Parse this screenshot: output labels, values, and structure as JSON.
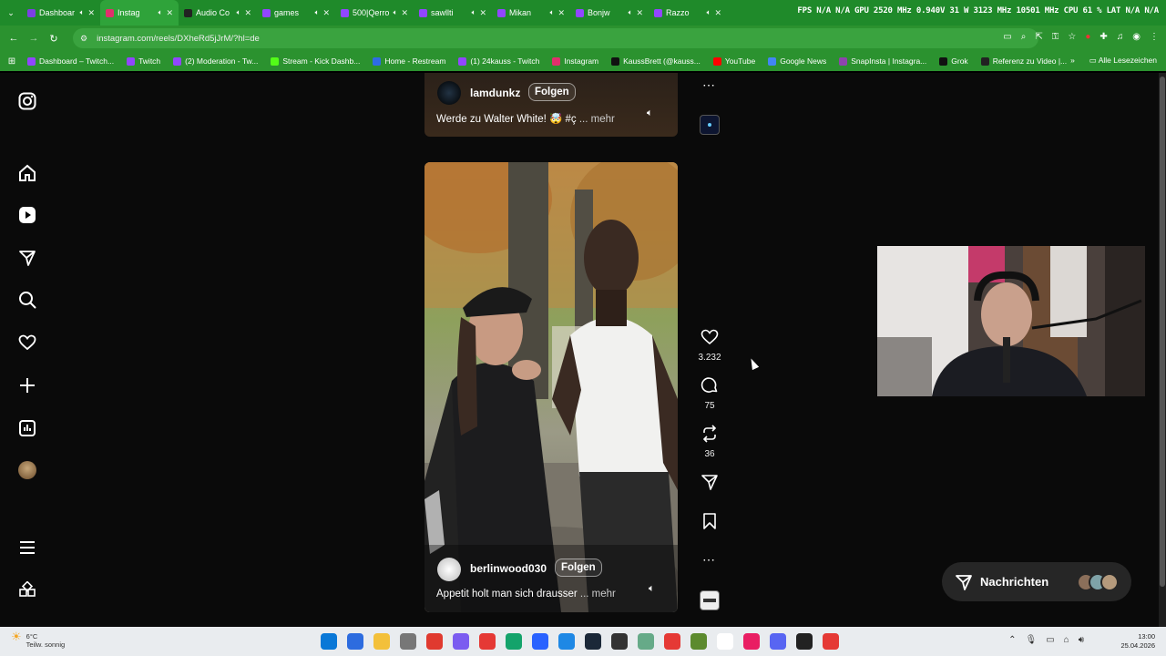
{
  "browser": {
    "tabs": [
      {
        "title": "Dashboar",
        "color": "#7b3fe4",
        "active": false
      },
      {
        "title": "Instag",
        "color": "#e1306c",
        "active": true
      },
      {
        "title": "Audio Co",
        "color": "#222222",
        "active": false
      },
      {
        "title": "games",
        "color": "#9146ff",
        "active": false
      },
      {
        "title": "500|Qerro",
        "color": "#9146ff",
        "active": false
      },
      {
        "title": "sawllti",
        "color": "#9146ff",
        "active": false
      },
      {
        "title": "Mikan",
        "color": "#9146ff",
        "active": false
      },
      {
        "title": "Bonjw",
        "color": "#9146ff",
        "active": false
      },
      {
        "title": "Razzo",
        "color": "#9146ff",
        "active": false
      }
    ],
    "overlay_stats": "FPS N/A N/A  GPU 2520 MHz 0.940V 31 W 3123 MHz 10501 MHz  CPU 61 %  LAT N/A N/A",
    "url": "instagram.com/reels/DXheRd5jJrM/?hl=de",
    "bookmarks": [
      {
        "label": "Dashboard – Twitch...",
        "color": "#9146ff"
      },
      {
        "label": "Twitch",
        "color": "#9146ff"
      },
      {
        "label": "(2) Moderation - Tw...",
        "color": "#9146ff"
      },
      {
        "label": "Stream - Kick Dashb...",
        "color": "#53fc18"
      },
      {
        "label": "Home - Restream",
        "color": "#2e6be6"
      },
      {
        "label": "(1) 24kauss - Twitch",
        "color": "#9146ff"
      },
      {
        "label": "Instagram",
        "color": "#e1306c"
      },
      {
        "label": "KaussBrett (@kauss...",
        "color": "#111111"
      },
      {
        "label": "YouTube",
        "color": "#ff0000"
      },
      {
        "label": "Google News",
        "color": "#4285f4"
      },
      {
        "label": "SnapInsta | Instagra...",
        "color": "#8e44ad"
      },
      {
        "label": "Grok",
        "color": "#111111"
      },
      {
        "label": "Referenz zu Video |...",
        "color": "#222222"
      }
    ],
    "bookmarks_more": "»",
    "all_bookmarks": "Alle Lesezeichen"
  },
  "reels": {
    "top": {
      "username": "lamdunkz",
      "follow_label": "Folgen",
      "caption": "Werde zu Walter White! 🤯 #ç",
      "more": "... mehr"
    },
    "main": {
      "username": "berlinwood030",
      "follow_label": "Folgen",
      "caption": "Appetit holt man sich drausser",
      "more": "... mehr"
    },
    "actions": {
      "likes": "3.232",
      "comments": "75",
      "reposts": "36"
    }
  },
  "messages": {
    "label": "Nachrichten"
  },
  "taskbar": {
    "weather_temp": "6°C",
    "weather_desc": "Teilw. sonnig",
    "time": "13:00",
    "date": "25.04.2026"
  }
}
